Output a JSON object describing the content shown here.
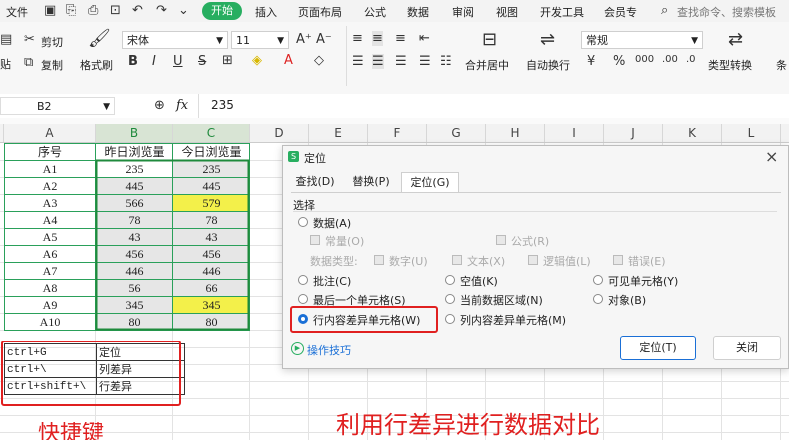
{
  "menubar": {
    "file": "文件",
    "start": "开始",
    "tabs": [
      "插入",
      "页面布局",
      "公式",
      "数据",
      "审阅",
      "视图",
      "开发工具",
      "会员专"
    ],
    "search_placeholder": "查找命令、搜索模板"
  },
  "ribbon": {
    "cut": "剪切",
    "copy": "复制",
    "paste_short": "贴",
    "format_painter": "格式刷",
    "font_name": "宋体",
    "font_size": "11",
    "merge_center": "合并居中",
    "wrap_text": "自动换行",
    "number_format": "常规",
    "type_convert": "类型转换",
    "conditional_short": "条"
  },
  "formula_bar": {
    "name_box": "B2",
    "fx": "fx",
    "value": "235"
  },
  "sheet": {
    "columns": [
      "A",
      "B",
      "C",
      "D",
      "E",
      "F",
      "G",
      "H",
      "I",
      "J",
      "K",
      "L"
    ],
    "headers": [
      "序号",
      "昨日浏览量",
      "今日浏览量"
    ],
    "rows": [
      {
        "a": "A1",
        "b": "235",
        "c": "235"
      },
      {
        "a": "A2",
        "b": "445",
        "c": "445"
      },
      {
        "a": "A3",
        "b": "566",
        "c": "579"
      },
      {
        "a": "A4",
        "b": "78",
        "c": "78"
      },
      {
        "a": "A5",
        "b": "43",
        "c": "43"
      },
      {
        "a": "A6",
        "b": "456",
        "c": "456"
      },
      {
        "a": "A7",
        "b": "446",
        "c": "446"
      },
      {
        "a": "A8",
        "b": "56",
        "c": "66"
      },
      {
        "a": "A9",
        "b": "345",
        "c": "345"
      },
      {
        "a": "A10",
        "b": "80",
        "c": "80"
      }
    ],
    "shortcuts": [
      {
        "key": "ctrl+G",
        "desc": "定位"
      },
      {
        "key": "ctrl+\\",
        "desc": "列差异"
      },
      {
        "key": "ctrl+shift+\\",
        "desc": "行差异"
      }
    ],
    "shortcut_title": "快捷键",
    "caption": "利用行差异进行数据对比"
  },
  "dialog": {
    "title": "定位",
    "tabs": [
      "查找(D)",
      "替换(P)",
      "定位(G)"
    ],
    "section": "选择",
    "data": "数据(A)",
    "constant": "常量(O)",
    "formula": "公式(R)",
    "data_type_label": "数据类型:",
    "types": [
      "数字(U)",
      "文本(X)",
      "逻辑值(L)",
      "错误(E)"
    ],
    "comment": "批注(C)",
    "blank": "空值(K)",
    "visible_cells": "可见单元格(Y)",
    "last_cell": "最后一个单元格(S)",
    "current_region": "当前数据区域(N)",
    "objects": "对象(B)",
    "row_diff": "行内容差异单元格(W)",
    "col_diff": "列内容差异单元格(M)",
    "tips": "操作技巧",
    "ok": "定位(T)",
    "close": "关闭"
  },
  "colors": {
    "accent_green": "#27ae60",
    "highlight_yellow": "#f3f04a",
    "annotation_red": "#e02020",
    "selected_blue": "#1a6fd6"
  }
}
